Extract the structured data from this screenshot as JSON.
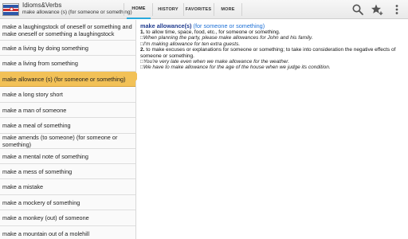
{
  "app": {
    "title": "Idioms&Verbs",
    "subtitle": "make allowance (s) (for someone or something)",
    "logo_icon": "flag-logo-icon"
  },
  "tabs": [
    {
      "label": "HOME",
      "active": true
    },
    {
      "label": "HISTORY",
      "active": false
    },
    {
      "label": "FAVORITES",
      "active": false
    },
    {
      "label": "MORE",
      "active": false
    }
  ],
  "toolbar": {
    "icons": [
      "search-icon",
      "favorite-star-add-icon",
      "overflow-menu-icon"
    ]
  },
  "list": {
    "items": [
      "make a laughingstock of oneself or something and make oneself or something a laughingstock",
      "make a living by doing something",
      "make a living from something",
      "make allowance (s) (for someone or something)",
      "make a long story short",
      "make a man of someone",
      "make a meal of something",
      "make amends (to someone) (for someone or something)",
      "make a mental note of something",
      "make a mess of something",
      "make a mistake",
      "make a mockery of something",
      "make a monkey (out) of someone",
      "make a mountain out of a molehill"
    ],
    "selected_index": 3
  },
  "definition": {
    "headword": "make allowance(s)",
    "headword_note": "(for someone or something)",
    "senses": [
      {
        "number": "1.",
        "text": "to allow time, space, food, etc., for someone or something.",
        "examples": [
          "When planning the party, please make allowances for John and his family.",
          "I'm making allowance for ten extra guests."
        ]
      },
      {
        "number": "2.",
        "text": "to make excuses or explanations for someone or something; to take into consideration the negative effects of someone or something.",
        "examples": [
          "You're very late even when we make allowance for the weather.",
          "We have to make allowance for the age of the house when we judge its condition."
        ]
      }
    ],
    "example_marker": "□"
  },
  "colors": {
    "accent": "#29a9dc",
    "selected_row": "#f2c157",
    "headword": "#1f3b8f",
    "headword_note": "#1b6fd6"
  }
}
